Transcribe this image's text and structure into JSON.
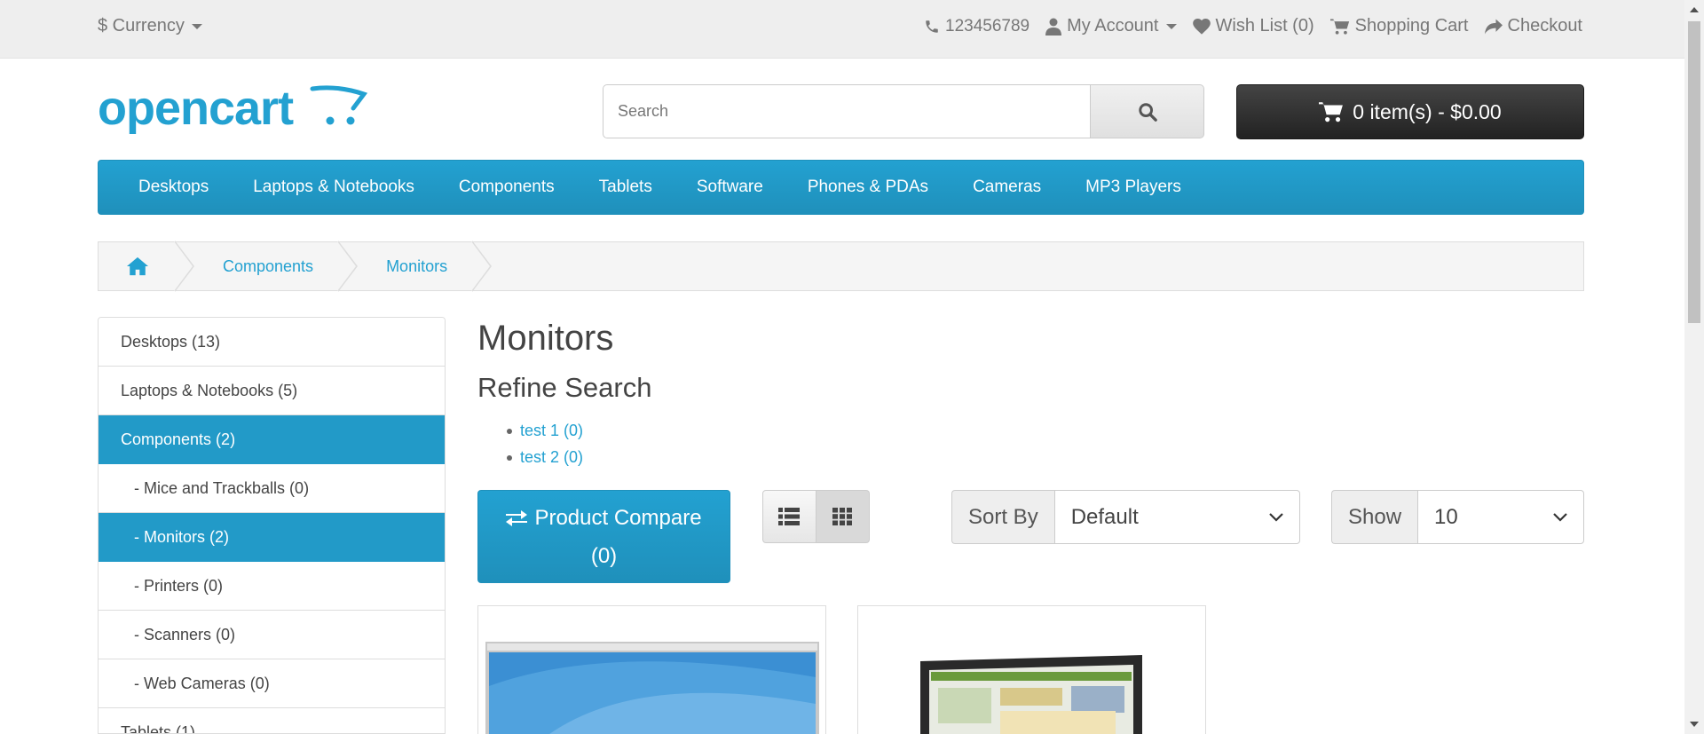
{
  "topbar": {
    "currency_label": "$ Currency",
    "phone": "123456789",
    "my_account": "My Account",
    "wishlist": "Wish List (0)",
    "shopping_cart": "Shopping Cart",
    "checkout": "Checkout"
  },
  "header": {
    "logo_text": "opencart",
    "search_placeholder": "Search",
    "cart_label": "0 item(s) - $0.00"
  },
  "menu": {
    "items": [
      "Desktops",
      "Laptops & Notebooks",
      "Components",
      "Tablets",
      "Software",
      "Phones & PDAs",
      "Cameras",
      "MP3 Players"
    ]
  },
  "breadcrumb": {
    "items": [
      "Components",
      "Monitors"
    ]
  },
  "sidebar": {
    "items": [
      {
        "label": "Desktops (13)"
      },
      {
        "label": "Laptops & Notebooks (5)"
      },
      {
        "label": "Components (2)"
      },
      {
        "label": "- Mice and Trackballs (0)"
      },
      {
        "label": "- Monitors (2)"
      },
      {
        "label": "- Printers (0)"
      },
      {
        "label": "- Scanners (0)"
      },
      {
        "label": "- Web Cameras (0)"
      },
      {
        "label": "Tablets (1)"
      }
    ]
  },
  "content": {
    "title": "Monitors",
    "refine_title": "Refine Search",
    "refine_items": [
      "test 1 (0)",
      "test 2 (0)"
    ],
    "compare_label": "Product Compare",
    "compare_count": "(0)",
    "sort_label": "Sort By",
    "sort_value": "Default",
    "show_label": "Show",
    "show_value": "10"
  },
  "colors": {
    "accent": "#229ac8",
    "cart_bg": "#363636",
    "topbar_bg": "#eeeeee"
  },
  "icons": [
    "phone-icon",
    "user-icon",
    "heart-icon",
    "cart-icon",
    "share-icon",
    "search-icon",
    "home-icon",
    "exchange-icon",
    "list-view-icon",
    "grid-view-icon",
    "chevron-down-icon"
  ]
}
